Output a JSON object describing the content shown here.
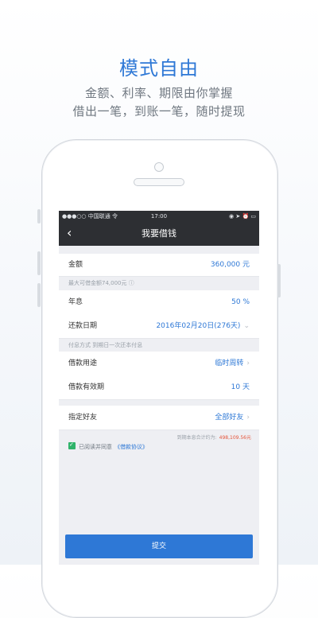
{
  "promo": {
    "title": "模式自由",
    "line1": "金额、利率、期限由你掌握",
    "line2": "借出一笔，到账一笔，随时提现"
  },
  "status_bar": {
    "carrier": "●●●○○ 中国联通 令",
    "time": "17:00",
    "icons": "◉ ➤ ⏰ ▭"
  },
  "nav": {
    "back_icon": "‹",
    "title": "我要借钱"
  },
  "form": {
    "amount": {
      "label": "金额",
      "value": "360,000 元"
    },
    "max_hint": "最大可借金额74,000元 ⓘ",
    "rate": {
      "label": "年息",
      "value": "50 %"
    },
    "repay_date": {
      "label": "还款日期",
      "value": "2016年02月20日(276天)",
      "chevron": "⌄"
    },
    "payment_hint": "付息方式 到期日一次还本付息",
    "purpose": {
      "label": "借款用途",
      "value": "临时周转",
      "chevron": "›"
    },
    "validity": {
      "label": "借款有效期",
      "value": "10 天"
    },
    "friend": {
      "label": "指定好友",
      "value": "全部好友",
      "chevron": "›"
    },
    "total": {
      "label": "到期本息合计约为:",
      "amount": "498,109.56元"
    },
    "agree": {
      "text": "已阅读并同意",
      "link": "《借款协议》"
    },
    "submit_label": "提交"
  },
  "colors": {
    "accent": "#2e78d6",
    "dark_bar": "#2d2f33",
    "check_green": "#2fb36a",
    "amount_red": "#e5543a"
  }
}
